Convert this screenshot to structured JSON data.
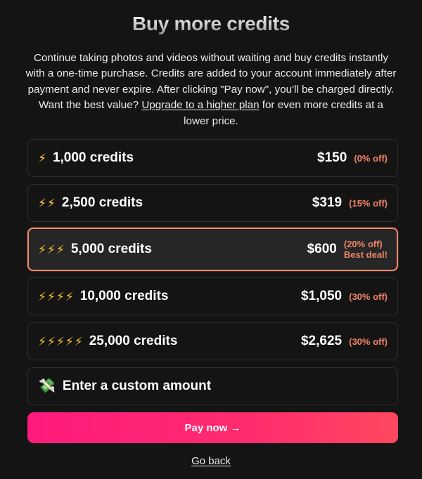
{
  "title": "Buy more credits",
  "description": {
    "text_before": "Continue taking photos and videos without waiting and buy credits instantly with a one-time purchase. Credits are added to your account immediately after payment and never expire. After clicking \"Pay now\", you'll be charged directly. Want the best value? ",
    "link": "Upgrade to a higher plan",
    "text_after": " for even more credits at a lower price."
  },
  "options": [
    {
      "bolts": "⚡",
      "label": "1,000 credits",
      "price": "$150",
      "discount": "(0% off)",
      "note": ""
    },
    {
      "bolts": "⚡⚡",
      "label": "2,500 credits",
      "price": "$319",
      "discount": "(15% off)",
      "note": ""
    },
    {
      "bolts": "⚡⚡⚡",
      "label": "5,000 credits",
      "price": "$600",
      "discount": "(20% off)",
      "note": "Best deal!",
      "selected": true
    },
    {
      "bolts": "⚡⚡⚡⚡",
      "label": "10,000 credits",
      "price": "$1,050",
      "discount": "(30% off)",
      "note": ""
    },
    {
      "bolts": "⚡⚡⚡⚡⚡",
      "label": "25,000 credits",
      "price": "$2,625",
      "discount": "(30% off)",
      "note": ""
    }
  ],
  "custom": {
    "icon": "💸",
    "label": "Enter a custom amount"
  },
  "pay_button": "Pay now →",
  "go_back": "Go back",
  "colors": {
    "background": "#141414",
    "accent_border": "#f08a6c",
    "discount_text": "#ef8366",
    "pay_gradient_start": "#ff1a7d",
    "pay_gradient_end": "#ff4860"
  }
}
